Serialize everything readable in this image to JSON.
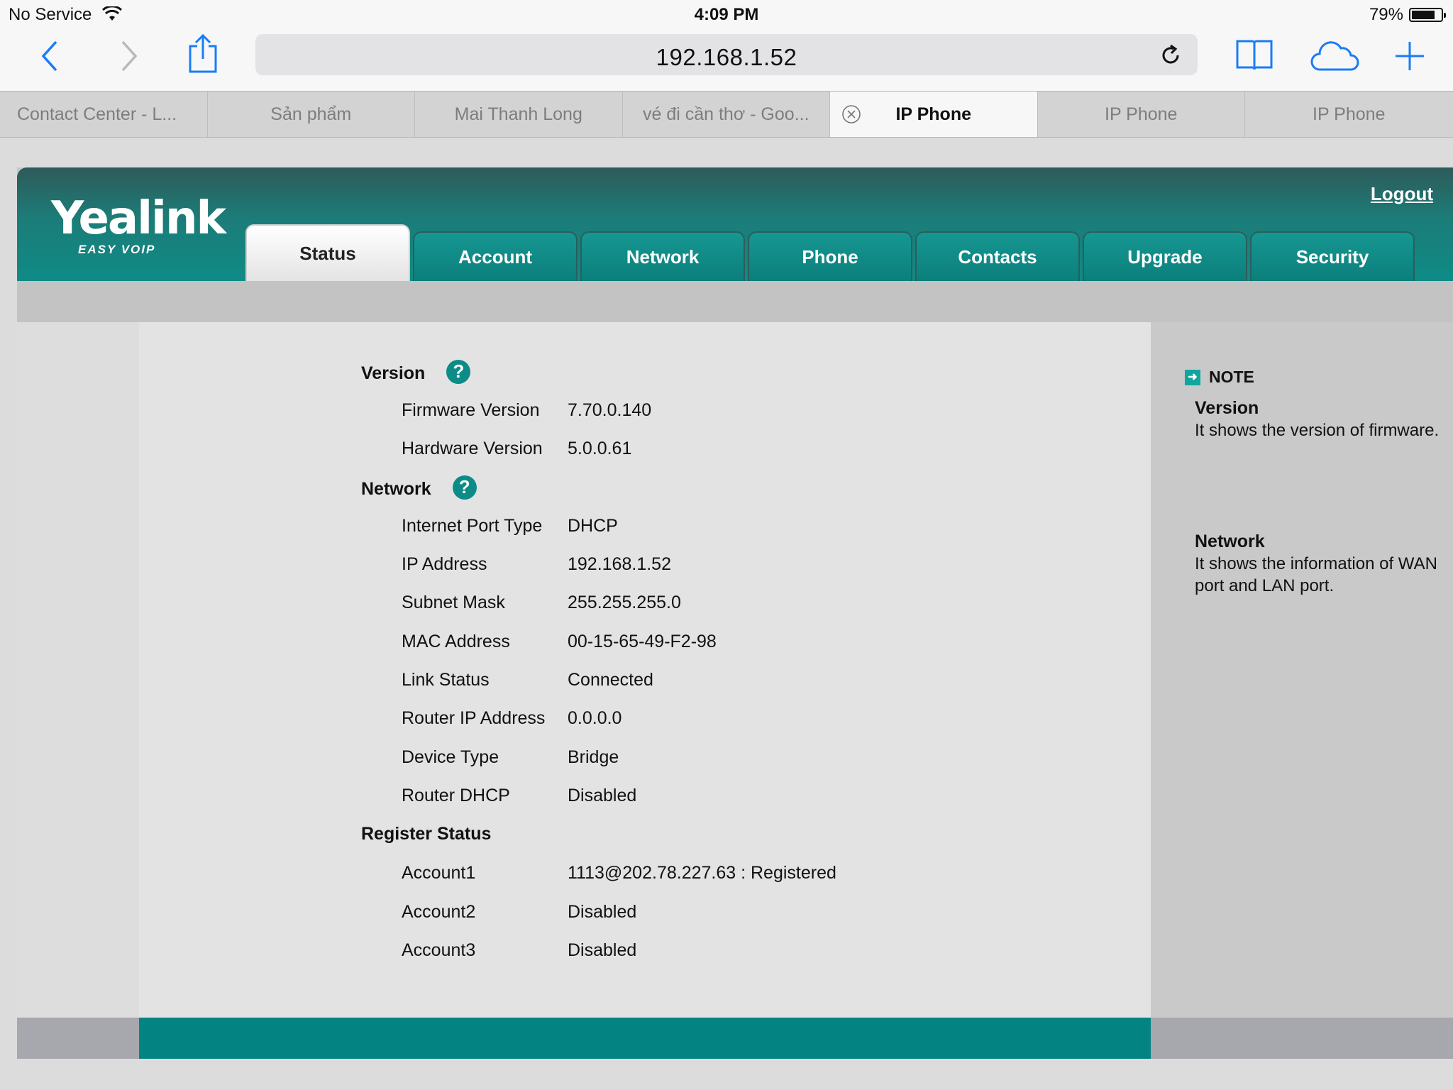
{
  "status_bar": {
    "carrier": "No Service",
    "time": "4:09 PM",
    "battery": "79%",
    "battery_level": 0.79
  },
  "browser": {
    "url": "192.168.1.52",
    "icons": [
      "back-icon",
      "forward-icon",
      "share-icon",
      "reload-icon",
      "bookmarks-icon",
      "icloud-tabs-icon",
      "new-tab-icon"
    ],
    "tabs": [
      {
        "label": "Contact Center - L...",
        "active": false
      },
      {
        "label": "Sản phẩm",
        "active": false
      },
      {
        "label": "Mai Thanh Long",
        "active": false
      },
      {
        "label": "vé đi cần thơ - Goo...",
        "active": false
      },
      {
        "label": "IP Phone",
        "active": true
      },
      {
        "label": "IP Phone",
        "active": false
      },
      {
        "label": "IP Phone",
        "active": false
      }
    ]
  },
  "app": {
    "brand": "Yealink",
    "tagline": "EASY VOIP",
    "logout": "Logout",
    "nav": [
      "Status",
      "Account",
      "Network",
      "Phone",
      "Contacts",
      "Upgrade",
      "Security"
    ],
    "active_nav": "Status",
    "accent_color": "#0c8b87"
  },
  "status": {
    "version": {
      "title": "Version",
      "rows": [
        {
          "label": "Firmware Version",
          "value": "7.70.0.140"
        },
        {
          "label": "Hardware Version",
          "value": "5.0.0.61"
        }
      ]
    },
    "network": {
      "title": "Network",
      "rows": [
        {
          "label": "Internet Port Type",
          "value": "DHCP"
        },
        {
          "label": "IP Address",
          "value": "192.168.1.52"
        },
        {
          "label": "Subnet Mask",
          "value": "255.255.255.0"
        },
        {
          "label": "MAC Address",
          "value": "00-15-65-49-F2-98"
        },
        {
          "label": "Link Status",
          "value": "Connected"
        },
        {
          "label": "Router IP Address",
          "value": "0.0.0.0"
        },
        {
          "label": "Device Type",
          "value": "Bridge"
        },
        {
          "label": "Router DHCP",
          "value": "Disabled"
        }
      ]
    },
    "register": {
      "title": "Register Status",
      "rows": [
        {
          "label": "Account1",
          "value": "1113@202.78.227.63 : Registered"
        },
        {
          "label": "Account2",
          "value": "Disabled"
        },
        {
          "label": "Account3",
          "value": "Disabled"
        }
      ]
    }
  },
  "note": {
    "heading": "NOTE",
    "items": [
      {
        "title": "Version",
        "text": "It shows the version of firmware."
      },
      {
        "title": "Network",
        "text": "It shows the information of WAN port and LAN port."
      }
    ]
  }
}
